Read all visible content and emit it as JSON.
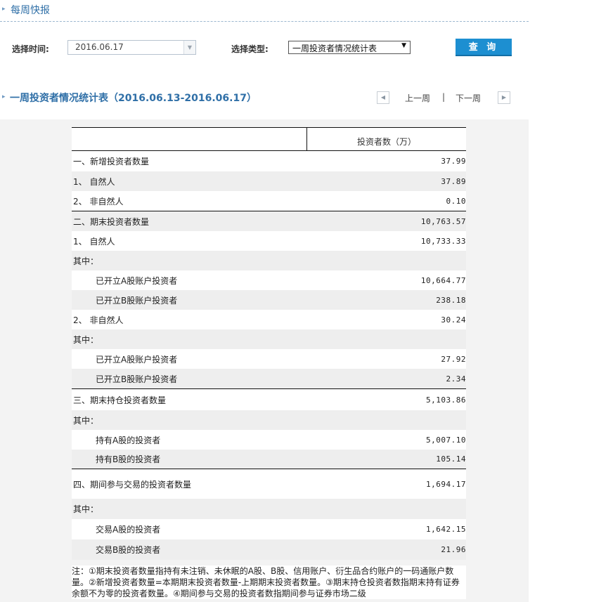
{
  "header": {
    "title": "每周快报"
  },
  "filters": {
    "time_label": "选择时间:",
    "time_value": "2016.06.17",
    "type_label": "选择类型:",
    "type_value": "一周投资者情况统计表",
    "query_button": "查 询"
  },
  "section": {
    "title": "一周投资者情况统计表（2016.06.13-2016.06.17）",
    "prev_week": "上一周",
    "separator": "|",
    "next_week": "下一周"
  },
  "table": {
    "column_header": "投资者数（万）",
    "rows": [
      {
        "label": "一、新增投资者数量",
        "value": "37.99"
      },
      {
        "label": "1、 自然人",
        "value": "37.89"
      },
      {
        "label": "2、 非自然人",
        "value": "0.10"
      },
      {
        "label": "二、期末投资者数量",
        "value": "10,763.57"
      },
      {
        "label": "1、 自然人",
        "value": "10,733.33"
      },
      {
        "label": "其中：",
        "value": ""
      },
      {
        "label": "已开立A股账户投资者",
        "value": "10,664.77"
      },
      {
        "label": "已开立B股账户投资者",
        "value": "238.18"
      },
      {
        "label": "2、 非自然人",
        "value": "30.24"
      },
      {
        "label": "其中：",
        "value": ""
      },
      {
        "label": "已开立A股账户投资者",
        "value": "27.92"
      },
      {
        "label": "已开立B股账户投资者",
        "value": "2.34"
      },
      {
        "label": "三、期末持仓投资者数量",
        "value": "5,103.86"
      },
      {
        "label": "其中：",
        "value": ""
      },
      {
        "label": "持有A股的投资者",
        "value": "5,007.10"
      },
      {
        "label": "持有B股的投资者",
        "value": "105.14"
      },
      {
        "label": "四、期间参与交易的投资者数量",
        "value": "1,694.17"
      },
      {
        "label": "其中：",
        "value": ""
      },
      {
        "label": "交易A股的投资者",
        "value": "1,642.15"
      },
      {
        "label": "交易B股的投资者",
        "value": "21.96"
      }
    ]
  },
  "note": "注：①期末投资者数量指持有未注销、未休眠的A股、B股、信用账户、衍生品合约账户的一码通账户数量。②新增投资者数量=本期期末投资者数量-上期期末投资者数量。③期末持仓投资者数指期末持有证券余额不为零的投资者数量。④期间参与交易的投资者数指期间参与证券市场二级"
}
